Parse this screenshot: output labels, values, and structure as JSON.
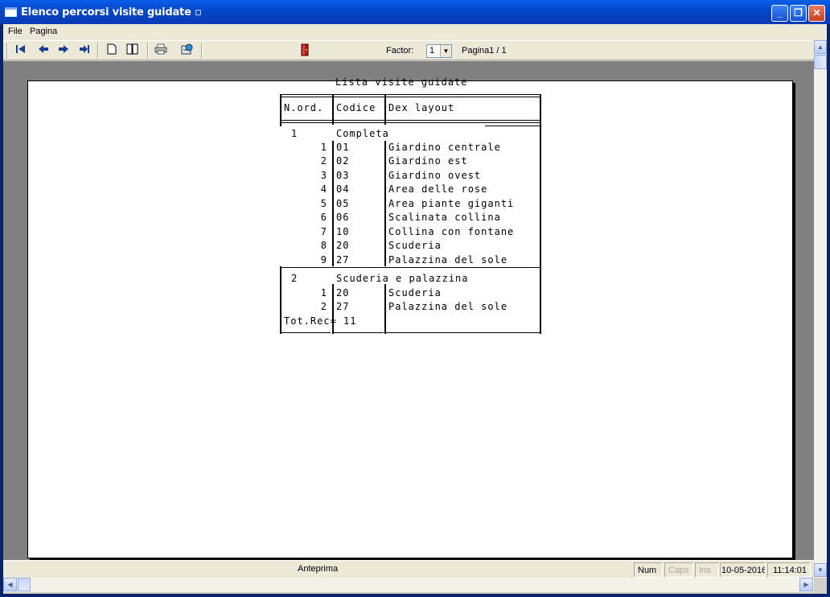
{
  "window": {
    "title": "Elenco percorsi visite guidate ▫",
    "minimize": "_",
    "maximize": "❐",
    "close": "✕"
  },
  "menu": {
    "file": "File",
    "pagina": "Pagina"
  },
  "toolbar": {
    "icons": [
      "first-page-icon",
      "prev-page-icon",
      "next-page-icon",
      "last-page-icon",
      "single-page-icon",
      "two-pages-icon",
      "print-icon",
      "export-icon",
      "exit-door-icon"
    ],
    "factor_label": "Factor:",
    "factor_value": "1",
    "page_indicator": "Pagina1 / 1"
  },
  "report": {
    "title": "Lista visite guidate",
    "headers": {
      "nord": "N.ord.",
      "codice": "Codice",
      "dex": "Dex layout"
    },
    "groups": [
      {
        "num": "1",
        "name": "Completa",
        "rows": [
          {
            "n": "1",
            "code": "01",
            "desc": "Giardino centrale"
          },
          {
            "n": "2",
            "code": "02",
            "desc": "Giardino est"
          },
          {
            "n": "3",
            "code": "03",
            "desc": "Giardino ovest"
          },
          {
            "n": "4",
            "code": "04",
            "desc": "Area delle rose"
          },
          {
            "n": "5",
            "code": "05",
            "desc": "Area piante giganti"
          },
          {
            "n": "6",
            "code": "06",
            "desc": "Scalinata collina"
          },
          {
            "n": "7",
            "code": "10",
            "desc": "Collina con fontane"
          },
          {
            "n": "8",
            "code": "20",
            "desc": "Scuderia"
          },
          {
            "n": "9",
            "code": "27",
            "desc": "Palazzina del sole"
          }
        ]
      },
      {
        "num": "2",
        "name": "Scuderia e palazzina",
        "rows": [
          {
            "n": "1",
            "code": "20",
            "desc": "Scuderia"
          },
          {
            "n": "2",
            "code": "27",
            "desc": "Palazzina del sole"
          }
        ]
      }
    ],
    "total": "Tot.Rec= 11"
  },
  "status": {
    "main": "Anteprima",
    "num": "Num",
    "caps": "Caps",
    "ins": "Ins",
    "date": "10-05-2016",
    "time": "11:14:01"
  }
}
